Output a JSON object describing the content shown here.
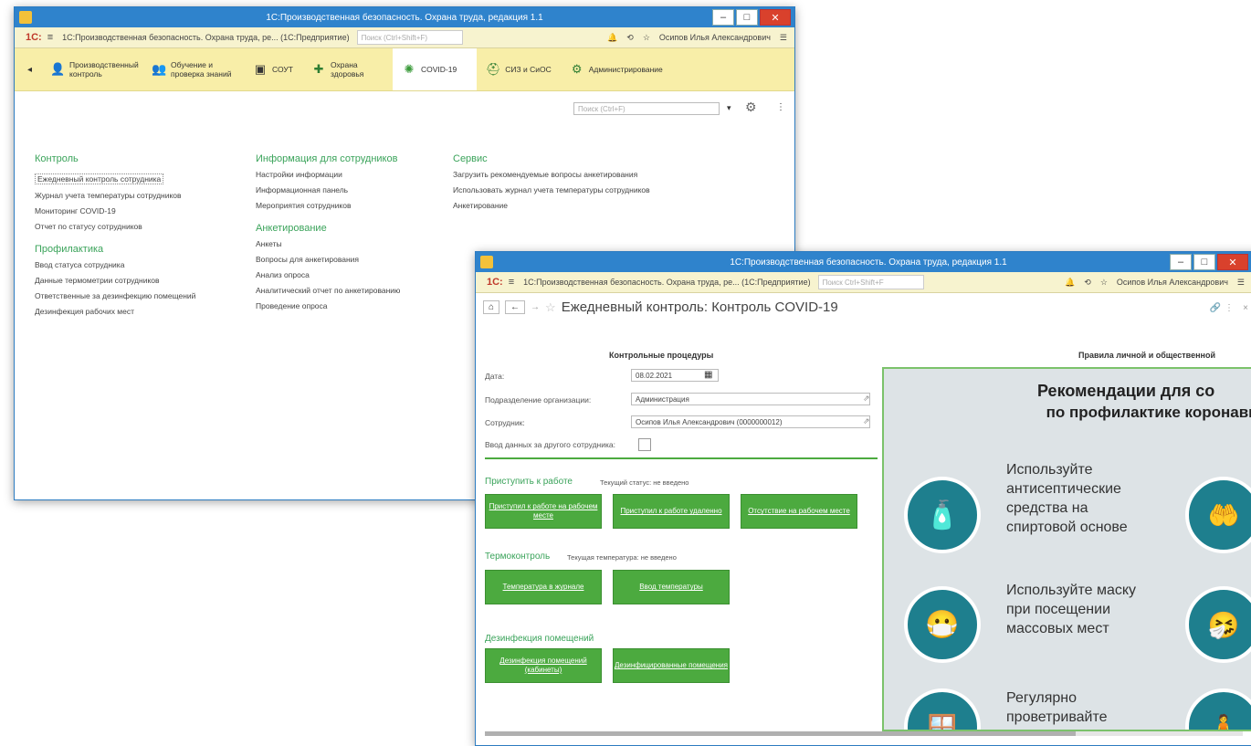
{
  "window1": {
    "title": "1С:Производственная безопасность. Охрана труда, редакция 1.1",
    "app_title": "1С:Производственная безопасность. Охрана труда, ре... (1С:Предприятие)",
    "search_placeholder": "Поиск (Ctrl+Shift+F)",
    "user": "Осипов Илья Александрович",
    "sections": [
      {
        "label": "Производственный контроль",
        "icon": "person-icon"
      },
      {
        "label": "Обучение и проверка знаний",
        "icon": "students-icon"
      },
      {
        "label": "СОУТ",
        "icon": "soot-icon"
      },
      {
        "label": "Охрана здоровья",
        "icon": "health-icon"
      },
      {
        "label": "COVID-19",
        "icon": "virus-icon"
      },
      {
        "label": "СИЗ и СиОС",
        "icon": "ppe-icon"
      },
      {
        "label": "Администрирование",
        "icon": "admin-icon"
      }
    ],
    "section_search": "Поиск (Ctrl+F)",
    "groups": {
      "control": {
        "title": "Контроль",
        "items": [
          "Ежедневный контроль сотрудника",
          "Журнал учета температуры сотрудников",
          "Мониторинг COVID-19",
          "Отчет по статусу сотрудников"
        ]
      },
      "prevention": {
        "title": "Профилактика",
        "items": [
          "Ввод статуса сотрудника",
          "Данные термометрии сотрудников",
          "Ответственные за дезинфекцию помещений",
          "Дезинфекция рабочих мест"
        ]
      },
      "info": {
        "title": "Информация для сотрудников",
        "items": [
          "Настройки информации",
          "Информационная панель",
          "Мероприятия сотрудников"
        ]
      },
      "survey": {
        "title": "Анкетирование",
        "items": [
          "Анкеты",
          "Вопросы для анкетирования",
          "Анализ опроса",
          "Аналитический отчет по анкетированию",
          "Проведение опроса"
        ]
      },
      "service": {
        "title": "Сервис",
        "items": [
          "Загрузить рекомендуемые вопросы анкетирования",
          "Использовать журнал учета температуры сотрудников",
          "Анкетирование"
        ]
      }
    }
  },
  "window2": {
    "title": "1С:Производственная безопасность. Охрана труда, редакция 1.1",
    "app_title": "1С:Производственная безопасность. Охрана труда, ре... (1С:Предприятие)",
    "search_placeholder": "Поиск Ctrl+Shift+F",
    "user": "Осипов Илья Александрович",
    "form_title": "Ежедневный контроль: Контроль COVID-19",
    "procedures_title": "Контрольные процедуры",
    "rules_title": "Правила личной и общественной",
    "date_label": "Дата:",
    "date_value": "08.02.2021",
    "dept_label": "Подразделение организации:",
    "dept_value": "Администрация",
    "employee_label": "Сотрудник:",
    "employee_value": "Осипов Илья Александрович (0000000012)",
    "other_label": "Ввод данных за другого сотрудника:",
    "work_title": "Приступить к работе",
    "work_status": "Текущий статус: не введено",
    "btn_work_place": "Приступил к работе на рабочем месте",
    "btn_work_remote": "Приступил к работе удаленно",
    "btn_absent": "Отсутствие на рабочем месте",
    "thermo_title": "Термоконтроль",
    "thermo_status": "Текущая температура: не введено",
    "btn_temp_journal": "Температура в журнале",
    "btn_temp_input": "Ввод температуры",
    "disinf_title": "Дезинфекция помещений",
    "btn_disinf_rooms": "Дезинфекция помещений (кабинеты)",
    "btn_disinf_done": "Дезинфицированные помещения",
    "poster_title1": "Рекомендации для со",
    "poster_title2": "по профилактике коронавир",
    "tip1": "Используйте антисептические средства на спиртовой основе",
    "tip2": "Используйте маску при посещении массовых мест",
    "tip3": "Регулярно проветривайте"
  }
}
